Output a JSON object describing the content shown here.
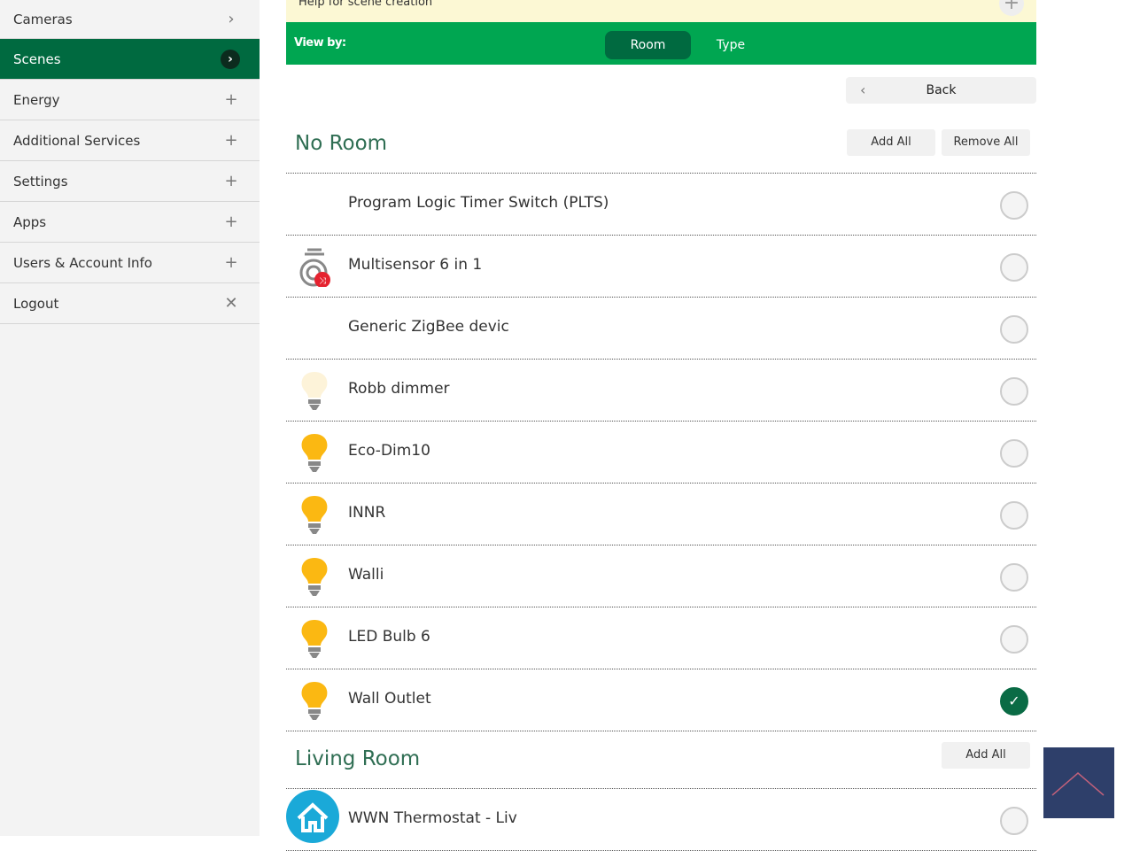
{
  "sidebar": {
    "items": [
      {
        "label": "Cameras",
        "icon": "chevron-right-icon",
        "glyph": "›"
      },
      {
        "label": "Scenes",
        "icon": "chevron-right-icon",
        "glyph": "›",
        "active": true
      },
      {
        "label": "Energy",
        "icon": "plus-icon",
        "glyph": "+"
      },
      {
        "label": "Additional Services",
        "icon": "plus-icon",
        "glyph": "+"
      },
      {
        "label": "Settings",
        "icon": "plus-icon",
        "glyph": "+"
      },
      {
        "label": "Apps",
        "icon": "plus-icon",
        "glyph": "+"
      },
      {
        "label": "Users & Account Info",
        "icon": "plus-icon",
        "glyph": "+"
      },
      {
        "label": "Logout",
        "icon": "close-icon",
        "glyph": "✕"
      }
    ]
  },
  "help": {
    "text": "Help for scene creation",
    "plus": "+"
  },
  "viewby": {
    "label": "View by:",
    "room": "Room",
    "type": "Type"
  },
  "back": {
    "label": "Back",
    "chev": "‹"
  },
  "sections": [
    {
      "title": "No Room",
      "add_all": "Add All",
      "remove_all": "Remove All",
      "devices": [
        {
          "name": "Program Logic Timer Switch (PLTS)",
          "icon": "none",
          "selected": false
        },
        {
          "name": "Multisensor 6 in 1",
          "icon": "multisensor-icon",
          "selected": false
        },
        {
          "name": "Generic ZigBee devic",
          "icon": "none",
          "selected": false
        },
        {
          "name": "Robb dimmer",
          "icon": "bulb-off-icon",
          "selected": false
        },
        {
          "name": "Eco-Dim10",
          "icon": "bulb-on-icon",
          "selected": false
        },
        {
          "name": "INNR",
          "icon": "bulb-on-icon",
          "selected": false
        },
        {
          "name": "Walli",
          "icon": "bulb-on-icon",
          "selected": false
        },
        {
          "name": "LED Bulb 6",
          "icon": "bulb-on-icon",
          "selected": false
        },
        {
          "name": "Wall Outlet",
          "icon": "bulb-on-icon",
          "selected": true
        }
      ]
    },
    {
      "title": "Living Room",
      "add_all": "Add All",
      "devices": [
        {
          "name": "WWN Thermostat - Liv",
          "icon": "thermostat-home-icon",
          "selected": false
        }
      ]
    }
  ],
  "colors": {
    "primary_green": "#00a651",
    "dark_green": "#006a40",
    "bulb_on": "#fbb812"
  },
  "check": "✓"
}
